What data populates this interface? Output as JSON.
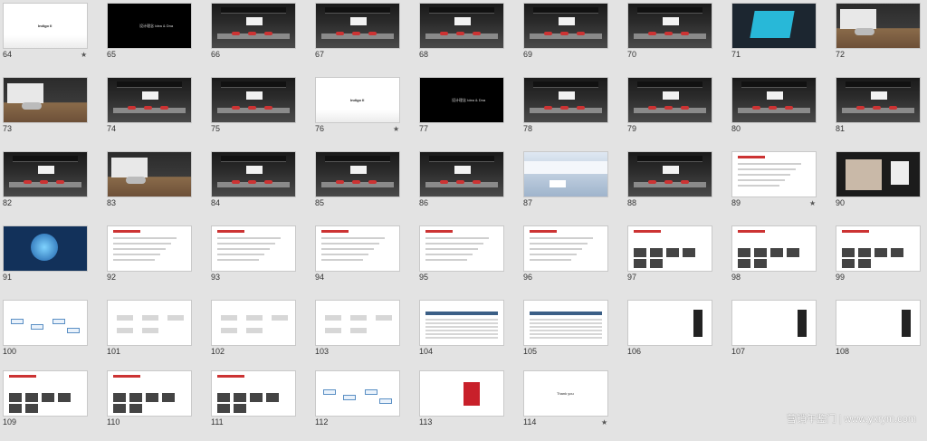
{
  "slides": [
    {
      "num": "64",
      "kind": "white",
      "star": true,
      "title": "Indigo II"
    },
    {
      "num": "65",
      "kind": "black",
      "star": false,
      "title": "设计理念  Idea & Dna"
    },
    {
      "num": "66",
      "kind": "hall",
      "star": false
    },
    {
      "num": "67",
      "kind": "hall",
      "star": false
    },
    {
      "num": "68",
      "kind": "hall",
      "star": false
    },
    {
      "num": "69",
      "kind": "hall",
      "star": false
    },
    {
      "num": "70",
      "kind": "hall",
      "star": false
    },
    {
      "num": "71",
      "kind": "cyan",
      "star": false
    },
    {
      "num": "72",
      "kind": "wood",
      "star": false
    },
    {
      "num": "73",
      "kind": "wood",
      "star": false
    },
    {
      "num": "74",
      "kind": "hall",
      "star": false
    },
    {
      "num": "75",
      "kind": "hall",
      "star": false
    },
    {
      "num": "76",
      "kind": "white",
      "star": true,
      "title": "Indigo II"
    },
    {
      "num": "77",
      "kind": "black",
      "star": false,
      "title": "设计理念  Idea & Dna"
    },
    {
      "num": "78",
      "kind": "hall",
      "star": false
    },
    {
      "num": "79",
      "kind": "hall",
      "star": false
    },
    {
      "num": "80",
      "kind": "hall",
      "star": false
    },
    {
      "num": "81",
      "kind": "hall",
      "star": false
    },
    {
      "num": "82",
      "kind": "hall",
      "star": false
    },
    {
      "num": "83",
      "kind": "wood",
      "star": false
    },
    {
      "num": "84",
      "kind": "hall",
      "star": false
    },
    {
      "num": "85",
      "kind": "hall",
      "star": false
    },
    {
      "num": "86",
      "kind": "hall",
      "star": false
    },
    {
      "num": "87",
      "kind": "blue",
      "star": false
    },
    {
      "num": "88",
      "kind": "hall",
      "star": false
    },
    {
      "num": "89",
      "kind": "text",
      "star": true
    },
    {
      "num": "90",
      "kind": "photo",
      "star": false
    },
    {
      "num": "91",
      "kind": "brain",
      "star": false
    },
    {
      "num": "92",
      "kind": "text",
      "star": false
    },
    {
      "num": "93",
      "kind": "text",
      "star": false
    },
    {
      "num": "94",
      "kind": "text",
      "star": false
    },
    {
      "num": "95",
      "kind": "text",
      "star": false
    },
    {
      "num": "96",
      "kind": "text",
      "star": false
    },
    {
      "num": "97",
      "kind": "imgs",
      "star": false
    },
    {
      "num": "98",
      "kind": "imgs",
      "star": false
    },
    {
      "num": "99",
      "kind": "imgs",
      "star": false
    },
    {
      "num": "100",
      "kind": "diag",
      "star": false
    },
    {
      "num": "101",
      "kind": "flow",
      "star": false
    },
    {
      "num": "102",
      "kind": "flow",
      "star": false
    },
    {
      "num": "103",
      "kind": "flow",
      "star": false
    },
    {
      "num": "104",
      "kind": "table",
      "star": false
    },
    {
      "num": "105",
      "kind": "table",
      "star": false
    },
    {
      "num": "106",
      "kind": "dev",
      "star": false
    },
    {
      "num": "107",
      "kind": "dev",
      "star": false
    },
    {
      "num": "108",
      "kind": "dev",
      "star": false
    },
    {
      "num": "109",
      "kind": "imgs",
      "star": false
    },
    {
      "num": "110",
      "kind": "imgs",
      "star": false
    },
    {
      "num": "111",
      "kind": "imgs",
      "star": false
    },
    {
      "num": "112",
      "kind": "diag",
      "star": false
    },
    {
      "num": "113",
      "kind": "red",
      "star": false
    },
    {
      "num": "114",
      "kind": "white2",
      "star": true,
      "title": "Thank you"
    }
  ],
  "star_glyph": "★",
  "watermark": "营销年鉴门 | www.yxrym.com"
}
